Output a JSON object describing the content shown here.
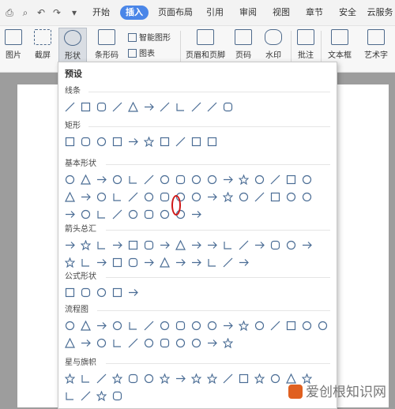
{
  "tabs": [
    {
      "label": "开始",
      "active": false
    },
    {
      "label": "插入",
      "active": true
    },
    {
      "label": "页面布局",
      "active": false
    },
    {
      "label": "引用",
      "active": false
    },
    {
      "label": "审阅",
      "active": false
    },
    {
      "label": "视图",
      "active": false
    },
    {
      "label": "章节",
      "active": false
    },
    {
      "label": "安全",
      "active": false
    },
    {
      "label": "云服务",
      "active": false
    }
  ],
  "ribbon": {
    "picture": "图片",
    "screenshot": "截屏",
    "shape": "形状",
    "barcode": "条形码",
    "smartart": "智能图形",
    "chart": "图表",
    "header_footer": "页眉和页脚",
    "page_number": "页码",
    "watermark": "水印",
    "comment": "批注",
    "textbox": "文本框",
    "wordart": "艺术字"
  },
  "panel": {
    "title": "预设",
    "categories": [
      {
        "name": "线条"
      },
      {
        "name": "矩形"
      },
      {
        "name": "基本形状"
      },
      {
        "name": "箭头总汇"
      },
      {
        "name": "公式形状"
      },
      {
        "name": "流程图"
      },
      {
        "name": "星与旗帜"
      }
    ]
  },
  "watermark_text": "爱创根知识网",
  "colors": {
    "accent": "#4a86e8",
    "shape": "#4b6d95",
    "highlight": "#d01818"
  }
}
